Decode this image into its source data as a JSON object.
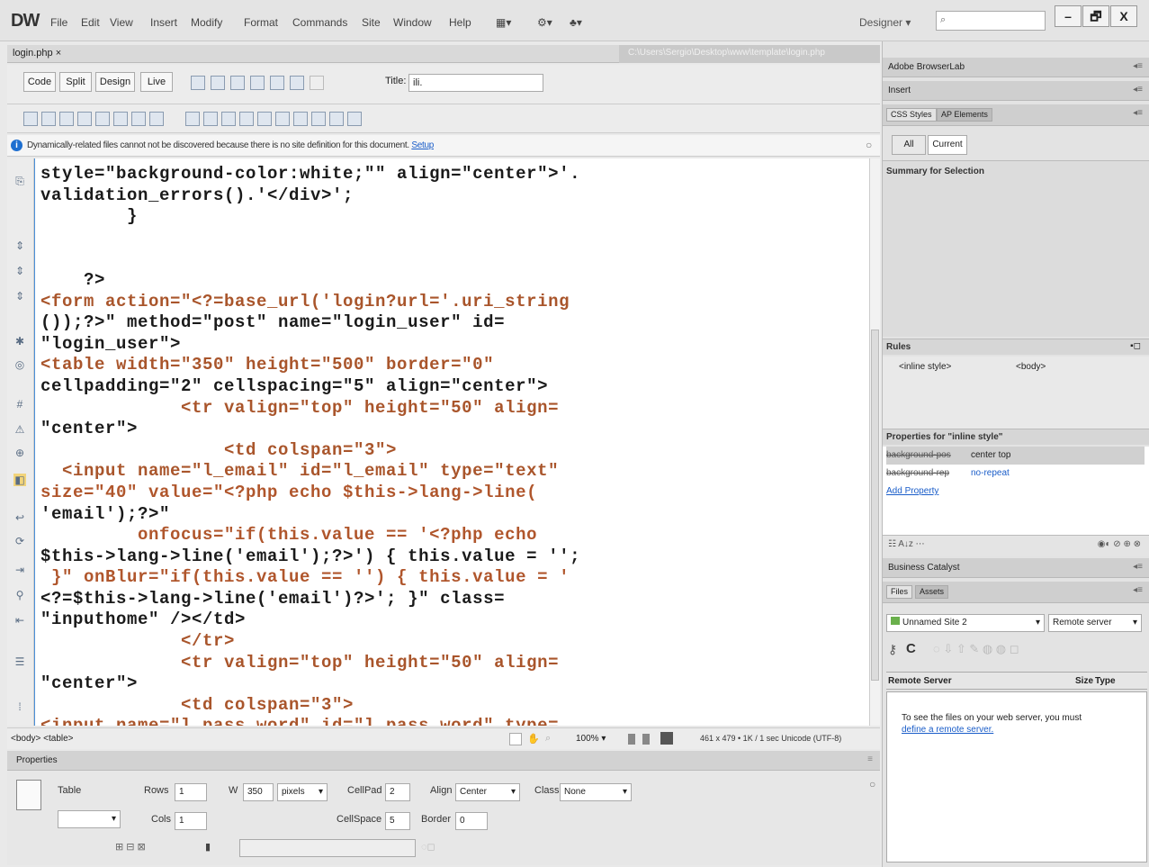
{
  "app": {
    "logo": "DW"
  },
  "menu": [
    "File",
    "Edit",
    "View",
    "Insert",
    "Modify",
    "Format",
    "Commands",
    "Site",
    "Window",
    "Help"
  ],
  "workspace": {
    "name": "Designer"
  },
  "window_buttons": [
    "–",
    "🗗",
    "X"
  ],
  "document": {
    "tab": "login.php",
    "path": "C:\\Users\\Sergio\\Desktop\\www\\template\\login.php",
    "views": [
      "Code",
      "Split",
      "Design",
      "Live"
    ],
    "title_label": "Title:",
    "title_value": "ili."
  },
  "info_bar": {
    "message": "Dynamically-related files cannot not be discovered because there is no site definition for this document.",
    "link": "Setup"
  },
  "code_lines": [
    "style=\"background-color:white;\"\" align=\"center\">'.",
    "validation_errors().'</div>';",
    "        }",
    "",
    "",
    "    ?>",
    "<form action=\"<?=base_url('login?url='.uri_string",
    "());?>\" method=\"post\" name=\"login_user\" id=",
    "\"login_user\">",
    "<table width=\"350\" height=\"500\" border=\"0\"",
    "cellpadding=\"2\" cellspacing=\"5\" align=\"center\">",
    "             <tr valign=\"top\" height=\"50\" align=",
    "\"center\">",
    "                 <td colspan=\"3\">",
    "  <input name=\"l_email\" id=\"l_email\" type=\"text\"",
    "size=\"40\" value=\"<?php echo $this->lang->line(",
    "'email');?>\"",
    "         onfocus=\"if(this.value == '<?php echo",
    "$this->lang->line('email');?>') { this.value = '';",
    " }\" onBlur=\"if(this.value == '') { this.value = '",
    "<?=$this->lang->line('email')?>'; }\" class=",
    "\"inputhome\" /></td>",
    "             </tr>",
    "             <tr valign=\"top\" height=\"50\" align=",
    "\"center\">",
    "             <td colspan=\"3\">",
    "<input name=\"l_pass_word\" id=\"l_pass_word\" type="
  ],
  "status": {
    "tags": "<body> <table>",
    "zoom": "100%",
    "info": "461 x 479 • 1K / 1 sec  Unicode (UTF-8)"
  },
  "properties": {
    "title": "Properties",
    "element": "Table",
    "rows_label": "Rows",
    "rows": "1",
    "cols_label": "Cols",
    "cols": "1",
    "w_label": "W",
    "w": "350",
    "w_unit": "pixels",
    "cellpad_label": "CellPad",
    "cellpad": "2",
    "cellspace_label": "CellSpace",
    "cellspace": "5",
    "align_label": "Align",
    "align": "Center",
    "border_label": "Border",
    "border": "0",
    "class_label": "Class",
    "class": "None"
  },
  "right_panel": {
    "browserlab": "Adobe BrowserLab",
    "insert": "Insert",
    "css_tabs": [
      "CSS Styles",
      "AP Elements"
    ],
    "css_modes": [
      "All",
      "Current"
    ],
    "summary_title": "Summary for Selection",
    "rules_title": "Rules",
    "rule_selector": "<inline style>",
    "rule_tag": "<body>",
    "props_title": "Properties for \"inline style\"",
    "prop_rows": [
      {
        "name": "background-pos",
        "value": "center top"
      },
      {
        "name": "background-rep",
        "value": "no-repeat"
      }
    ],
    "add_property": "Add Property",
    "business_catalyst": "Business Catalyst",
    "files_tabs": [
      "Files",
      "Assets"
    ],
    "site_select": "Unnamed Site 2",
    "server_select": "Remote server",
    "col_remote": "Remote Server",
    "col_size": "Size",
    "col_type": "Type",
    "files_msg": "To see the files on your web server, you must",
    "files_link": "define a remote server."
  }
}
